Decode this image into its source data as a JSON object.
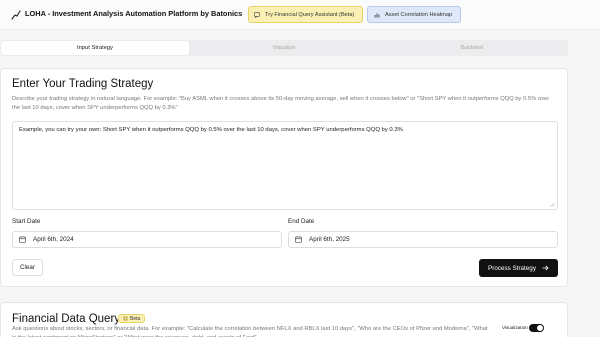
{
  "header": {
    "title": "LOHA - Investment Analysis Automation Platform by Batonics",
    "assistant_button": "Try Financial Query Assistant (Beta)",
    "heatmap_button": "Asset Correlation Heatmap"
  },
  "tabs": [
    {
      "label": "Input Strategy",
      "active": true
    },
    {
      "label": "Visualize",
      "active": false
    },
    {
      "label": "Backtest",
      "active": false
    }
  ],
  "strategy": {
    "heading": "Enter Your Trading Strategy",
    "description": "Describe your trading strategy in natural language. For example: \"Buy ASML when it crosses above its 50-day moving average, sell when it crosses below\" or \"Short SPY when it outperforms QQQ by 0.5% over the last 10 days, cover when SPY underperforms QQQ by 0.3%\"",
    "input_value": "Example, you can try your own: Short SPY when it outperforms QQQ by 0.5% over the last 10 days, cover when SPY underperforms QQQ by 0.3%",
    "start_date_label": "Start Date",
    "start_date_value": "April 6th, 2024",
    "end_date_label": "End Date",
    "end_date_value": "April 6th, 2025",
    "clear_label": "Clear",
    "process_label": "Process Strategy"
  },
  "query": {
    "heading": "Financial Data Query",
    "beta_label": "Beta",
    "description": "Ask questions about stocks, sectors, or financial data. For example: \"Calculate the correlation between NFLX and RBLX last 10 days\", \"Who are the CEOs of Pfizer and Moderna\", \"What is the latest sentiment on MicroStrategy\" or \"What were the revenues, debt, and assets of Ford\"",
    "visualization_label": "Visualization",
    "visualization_on": true
  },
  "colors": {
    "assistant_bg": "#fbf0b3",
    "heatmap_bg": "#dde8f8",
    "primary": "#111111"
  },
  "icons": {
    "logo": "chart-line-icon",
    "assistant": "message-icon",
    "heatmap": "bar-chart-icon",
    "calendar": "calendar-icon",
    "process": "arrow-right-icon",
    "beta": "star-icon"
  }
}
